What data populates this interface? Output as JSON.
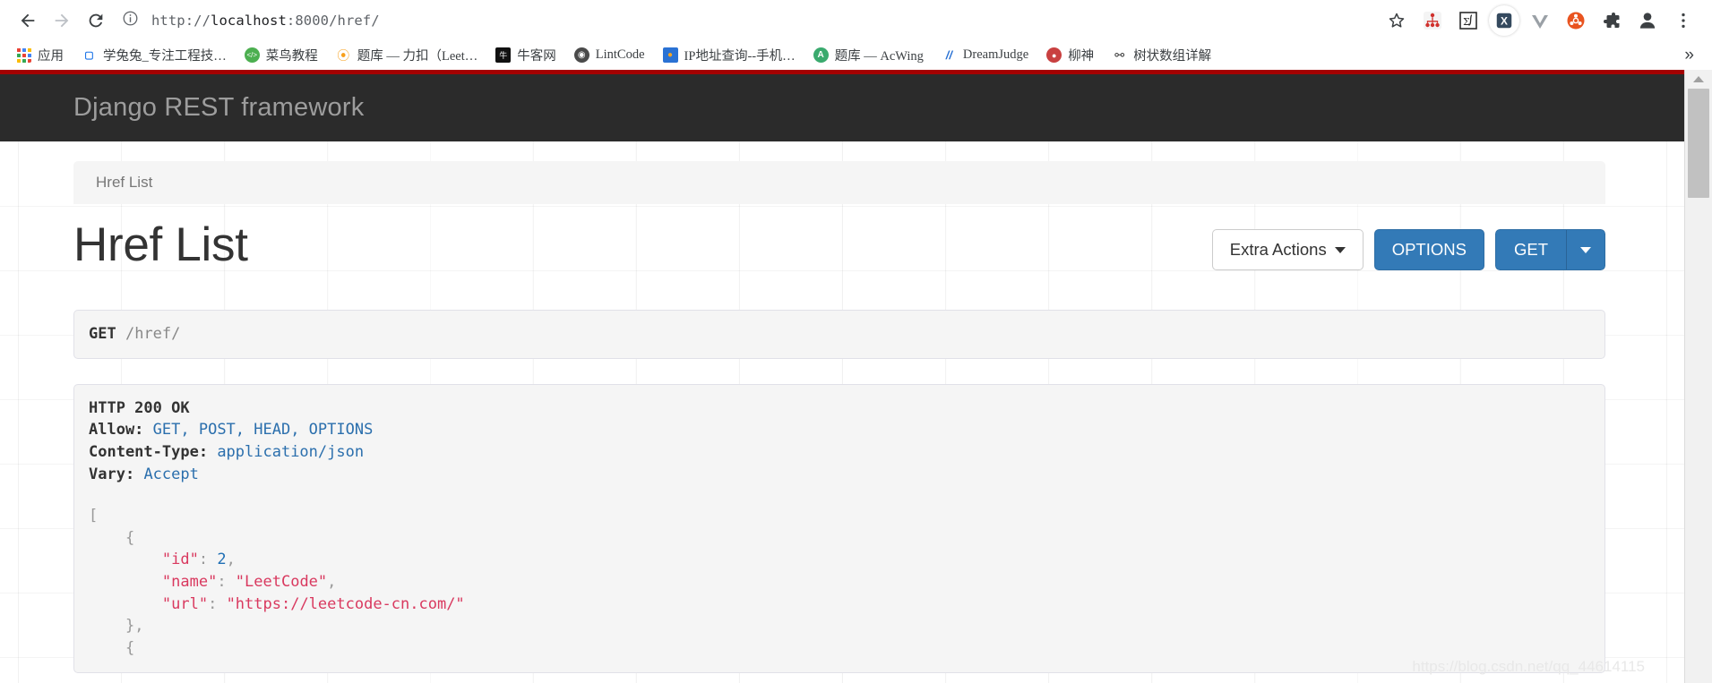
{
  "browser": {
    "url_scheme": "http://",
    "url_host": "localhost",
    "url_rest": ":8000/href/",
    "url_full": "http://localhost:8000/href/",
    "back_icon": "back-arrow-icon",
    "forward_icon": "forward-arrow-icon",
    "reload_icon": "reload-icon",
    "info_icon": "info-circle-icon",
    "toolbar_icons": [
      {
        "name": "bookmark-star-icon",
        "glyph": "☆",
        "color": "#5f6368"
      },
      {
        "name": "sitemap-extension-icon",
        "glyph": "",
        "color": "#d0312d"
      },
      {
        "name": "math-integral-extension-icon",
        "glyph": "Σ∫",
        "color": "#333333"
      },
      {
        "name": "x-extension-icon",
        "glyph": "X",
        "color": "#ffffff"
      },
      {
        "name": "vue-devtools-icon",
        "glyph": "V",
        "color": "#9aa0a6"
      },
      {
        "name": "ubuntu-extension-icon",
        "glyph": "",
        "color": "#e95420"
      },
      {
        "name": "extensions-puzzle-icon",
        "glyph": "",
        "color": "#5f6368"
      },
      {
        "name": "profile-avatar-icon",
        "glyph": "",
        "color": "#3c4043"
      },
      {
        "name": "chrome-menu-icon",
        "glyph": "⋮",
        "color": "#3c4043"
      }
    ],
    "bookmarks": [
      {
        "label": "应用",
        "icon": "apps-grid-icon",
        "icon_kind": "grid"
      },
      {
        "label": "学兔兔_专注工程技…",
        "icon": "xuetutu-icon",
        "icon_kind": "blue-glyph",
        "icon_text": "ᴅᴄ",
        "icon_bg": "#ffffff",
        "icon_fg": "#1a73e8"
      },
      {
        "label": "菜鸟教程",
        "icon": "runoob-icon",
        "icon_kind": "round",
        "icon_text": "</>",
        "icon_bg": "#4caf50",
        "icon_fg": "#ffffff"
      },
      {
        "label": "题库 — 力扣（Leet…",
        "icon": "leetcode-icon",
        "icon_kind": "glyph",
        "icon_text": "⬡",
        "icon_bg": "#ffffff",
        "icon_fg": "#f8a01c"
      },
      {
        "label": "牛客网",
        "icon": "nowcoder-icon",
        "icon_kind": "square",
        "icon_text": "牛",
        "icon_bg": "#111111",
        "icon_fg": "#ffffff"
      },
      {
        "label": "LintCode",
        "icon": "lintcode-icon",
        "icon_kind": "round",
        "icon_text": "⊕",
        "icon_bg": "#4a4a4a",
        "icon_fg": "#ffffff"
      },
      {
        "label": "IP地址查询--手机…",
        "icon": "ip-lookup-icon",
        "icon_kind": "square",
        "icon_text": "◆",
        "icon_bg": "#2a72d4",
        "icon_fg": "#f5a623"
      },
      {
        "label": "题库 — AcWing",
        "icon": "acwing-icon",
        "icon_kind": "round",
        "icon_text": "A",
        "icon_bg": "#3aaa6e",
        "icon_fg": "#ffffff"
      },
      {
        "label": "DreamJudge",
        "icon": "dreamjudge-icon",
        "icon_kind": "glyph",
        "icon_text": "//",
        "icon_bg": "#ffffff",
        "icon_fg": "#2a72d4"
      },
      {
        "label": "柳神",
        "icon": "liushen-avatar-icon",
        "icon_kind": "round",
        "icon_text": "♣",
        "icon_bg": "#c94040",
        "icon_fg": "#ffffff"
      },
      {
        "label": "树状数组详解",
        "icon": "csdn-article-icon",
        "icon_kind": "glyph",
        "icon_text": "❂",
        "icon_bg": "#ffffff",
        "icon_fg": "#333333"
      }
    ],
    "bookmarks_overflow": "»"
  },
  "navbar": {
    "brand": "Django REST framework",
    "accent_stripe_color": "#a30000",
    "background_color": "#2b2b2b"
  },
  "breadcrumb": {
    "items": [
      "Href List"
    ],
    "current": "Href List"
  },
  "page": {
    "title": "Href List"
  },
  "actions": {
    "extra_actions_label": "Extra Actions",
    "options_label": "OPTIONS",
    "get_label": "GET",
    "get_caret": "caret-down-icon",
    "primary_color": "#337ab7"
  },
  "request": {
    "method": "GET",
    "path": "/href/"
  },
  "response": {
    "status_line": "HTTP 200 OK",
    "headers": [
      {
        "key": "Allow:",
        "value": "GET, POST, HEAD, OPTIONS"
      },
      {
        "key": "Content-Type:",
        "value": "application/json"
      },
      {
        "key": "Vary:",
        "value": "Accept"
      }
    ],
    "body_lines": [
      {
        "indent": 0,
        "parts": [
          {
            "t": "punct",
            "v": "["
          }
        ]
      },
      {
        "indent": 1,
        "parts": [
          {
            "t": "punct",
            "v": "{"
          }
        ]
      },
      {
        "indent": 2,
        "parts": [
          {
            "t": "key",
            "v": "\"id\""
          },
          {
            "t": "punct",
            "v": ": "
          },
          {
            "t": "num",
            "v": "2"
          },
          {
            "t": "punct",
            "v": ","
          }
        ]
      },
      {
        "indent": 2,
        "parts": [
          {
            "t": "key",
            "v": "\"name\""
          },
          {
            "t": "punct",
            "v": ": "
          },
          {
            "t": "str",
            "v": "\"LeetCode\""
          },
          {
            "t": "punct",
            "v": ","
          }
        ]
      },
      {
        "indent": 2,
        "parts": [
          {
            "t": "key",
            "v": "\"url\""
          },
          {
            "t": "punct",
            "v": ": "
          },
          {
            "t": "str",
            "v": "\"https://leetcode-cn.com/\""
          }
        ]
      },
      {
        "indent": 1,
        "parts": [
          {
            "t": "punct",
            "v": "},"
          }
        ]
      },
      {
        "indent": 1,
        "parts": [
          {
            "t": "punct",
            "v": "{"
          }
        ]
      }
    ]
  },
  "watermark": "https://blog.csdn.net/qq_44614115",
  "scrollbar": {
    "up_arrow_icon": "scroll-up-arrow-icon",
    "thumb_name": "scroll-thumb"
  }
}
